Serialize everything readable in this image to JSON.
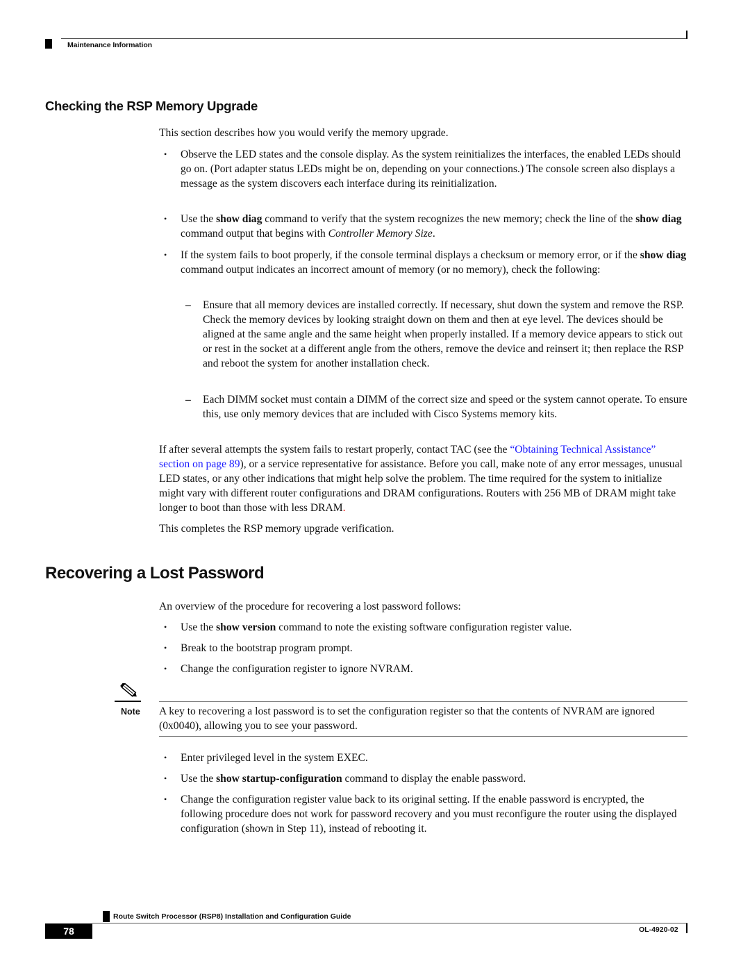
{
  "header": {
    "section": "Maintenance Information"
  },
  "section1": {
    "title": "Checking the RSP Memory Upgrade",
    "intro": "This section describes how you would verify the memory upgrade.",
    "bullets": [
      {
        "text": "Observe the LED states and the console display. As the system reinitializes the interfaces, the enabled LEDs should go on. (Port adapter status LEDs might be on, depending on your connections.) The console screen also displays a message as the system discovers each interface during its reinitialization."
      },
      {
        "pre": "Use the ",
        "cmd1": "show diag",
        "mid": " command to verify that the system recognizes the new memory; check the line of the ",
        "cmd2": "show diag",
        "mid2": " command output that begins with ",
        "italic": "Controller Memory Size",
        "post": "."
      },
      {
        "pre": "If the system fails to boot properly, if the console terminal displays a checksum or memory error, or if the ",
        "cmd": "show diag",
        "post": " command output indicates an incorrect amount of memory (or no memory), check the following:"
      }
    ],
    "subitems": [
      "Ensure that all memory devices are installed correctly. If necessary, shut down the system and remove the RSP. Check the memory devices by looking straight down on them and then at eye level. The devices should be aligned at the same angle and the same height when properly installed. If a memory device appears to stick out or rest in the socket at a different angle from the others, remove the device and reinsert it; then replace the RSP and reboot the system for another installation check.",
      "Each DIMM socket must contain a DIMM of the correct size and speed or the system cannot operate. To ensure this, use only memory devices that are included with Cisco Systems memory kits."
    ],
    "support_para": {
      "pre": "If after several attempts the system fails to restart properly, contact TAC (see the ",
      "link": "“Obtaining Technical Assistance” section on page 89",
      "post": "), or a service representative for assistance. Before you call, make note of any error messages, unusual LED states, or any other indications that might help solve the problem. The time required for the system to initialize might vary with different router configurations and DRAM configurations. Routers with 256 MB of DRAM might take longer to boot than those with less DRAM",
      "end": "."
    },
    "closing": "This completes the RSP memory upgrade verification."
  },
  "section2": {
    "title": "Recovering a Lost Password",
    "intro": "An overview of the procedure for recovering a lost password follows:",
    "bullets": [
      {
        "pre": "Use the ",
        "cmd": "show version",
        "post": " command to note the existing software configuration register value."
      },
      {
        "text": "Break to the bootstrap program prompt."
      },
      {
        "text": "Change the configuration register to ignore NVRAM."
      }
    ],
    "note": {
      "label": "Note",
      "icon": "pencil-note-icon",
      "text": "A key to recovering a lost password is to set the configuration register so that the contents of NVRAM are ignored (0x0040), allowing you to see your password."
    },
    "bullets2": [
      {
        "text": "Enter privileged level in the system EXEC."
      },
      {
        "pre": "Use the ",
        "cmd": "show startup-configuration",
        "post": " command to display the enable password."
      },
      {
        "text": "Change the configuration register value back to its original setting. If the enable password is encrypted, the following procedure does not work for password recovery and you must reconfigure the router using the displayed configuration (shown in Step 11), instead of rebooting it."
      }
    ]
  },
  "footer": {
    "guide_title": "Route Switch Processor (RSP8) Installation and Configuration Guide",
    "page_number": "78",
    "doc_id": "OL-4920-02"
  },
  "bullet_glyph": "•",
  "dash_glyph": "–"
}
